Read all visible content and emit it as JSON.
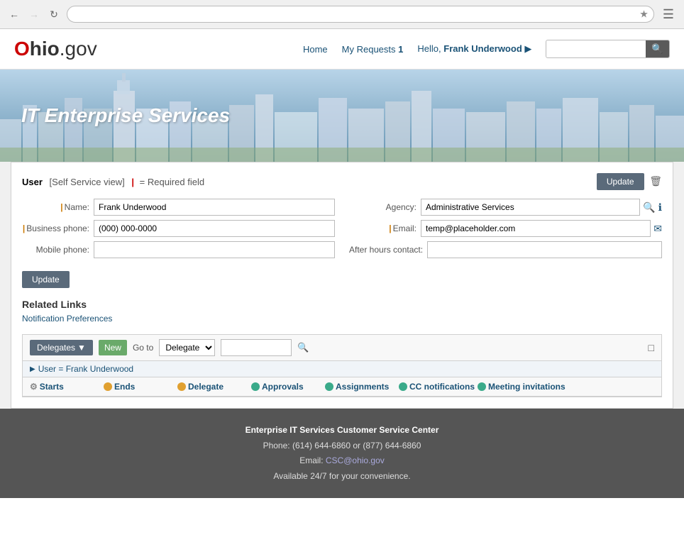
{
  "browser": {
    "back_disabled": false,
    "forward_disabled": true,
    "address": ""
  },
  "header": {
    "logo_ohio": "hio",
    "logo_gov": ".gov",
    "nav": {
      "home": "Home",
      "my_requests": "My Requests",
      "my_requests_count": "1",
      "hello": "Hello, ",
      "username": "Frank Underwood",
      "chevron": "▶"
    },
    "search_placeholder": ""
  },
  "hero": {
    "title": "IT Enterprise Services"
  },
  "form": {
    "title": "User",
    "view_label": "[Self Service view]",
    "required_label": "= Required field",
    "update_button": "Update",
    "name_label": "Name:",
    "name_value": "Frank Underwood",
    "agency_label": "Agency:",
    "agency_value": "Administrative Services",
    "business_phone_label": "Business phone:",
    "business_phone_value": "(000) 000-0000",
    "email_label": "Email:",
    "email_value": "temp@placeholder.com",
    "mobile_phone_label": "Mobile phone:",
    "mobile_phone_value": "",
    "after_hours_label": "After hours contact:",
    "after_hours_value": "",
    "update_button_bottom": "Update"
  },
  "related_links": {
    "title": "Related Links",
    "notification_preferences": "Notification Preferences"
  },
  "delegates": {
    "button_label": "Delegates",
    "new_button": "New",
    "goto_label": "Go to",
    "goto_option": "Delegate",
    "filter_text": "User = Frank Underwood",
    "columns": [
      {
        "icon_type": "gear",
        "label": "Starts"
      },
      {
        "icon_type": "orange",
        "label": "Ends"
      },
      {
        "icon_type": "orange",
        "label": "Delegate"
      },
      {
        "icon_type": "teal",
        "label": "Approvals"
      },
      {
        "icon_type": "teal",
        "label": "Assignments"
      },
      {
        "icon_type": "teal",
        "label": "CC notifications"
      },
      {
        "icon_type": "teal",
        "label": "Meeting invitations"
      }
    ]
  },
  "footer": {
    "title": "Enterprise IT Services Customer Service Center",
    "phone": "Phone: (614) 644-6860 or (877) 644-6860",
    "email_label": "Email: ",
    "email": "CSC@ohio.gov",
    "availability": "Available 24/7 for your convenience."
  }
}
